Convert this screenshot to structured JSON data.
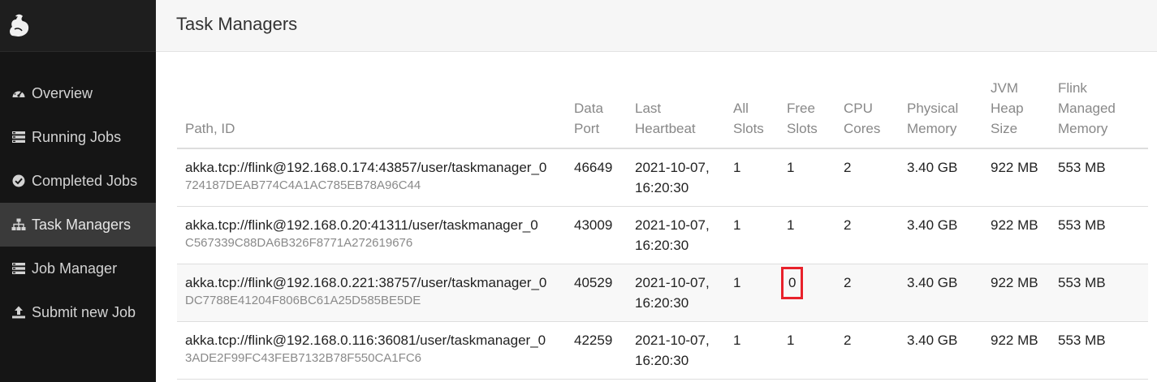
{
  "header": {
    "title": "Task Managers"
  },
  "sidebar": {
    "items": [
      {
        "label": "Overview",
        "icon": "dashboard-icon",
        "active": false
      },
      {
        "label": "Running Jobs",
        "icon": "list-icon",
        "active": false
      },
      {
        "label": "Completed Jobs",
        "icon": "check-circle-icon",
        "active": false
      },
      {
        "label": "Task Managers",
        "icon": "sitemap-icon",
        "active": true
      },
      {
        "label": "Job Manager",
        "icon": "list-icon",
        "active": false
      },
      {
        "label": "Submit new Job",
        "icon": "upload-icon",
        "active": false
      }
    ]
  },
  "table": {
    "columns": [
      {
        "line1": "",
        "line2": "",
        "line3": "Path, ID"
      },
      {
        "line1": "",
        "line2": "Data",
        "line3": "Port"
      },
      {
        "line1": "",
        "line2": "Last",
        "line3": "Heartbeat"
      },
      {
        "line1": "",
        "line2": "All",
        "line3": "Slots"
      },
      {
        "line1": "",
        "line2": "Free",
        "line3": "Slots"
      },
      {
        "line1": "",
        "line2": "CPU",
        "line3": "Cores"
      },
      {
        "line1": "",
        "line2": "Physical",
        "line3": "Memory"
      },
      {
        "line1": "JVM",
        "line2": "Heap",
        "line3": "Size"
      },
      {
        "line1": "Flink",
        "line2": "Managed",
        "line3": "Memory"
      }
    ],
    "rows": [
      {
        "path": "akka.tcp://flink@192.168.0.174:43857/user/taskmanager_0",
        "id": "724187DEAB774C4A1AC785EB78A96C44",
        "data_port": "46649",
        "heartbeat_date": "2021-10-07,",
        "heartbeat_time": "16:20:30",
        "all_slots": "1",
        "free_slots": "1",
        "cpu_cores": "2",
        "physical_memory": "3.40 GB",
        "jvm_heap": "922 MB",
        "flink_managed": "553 MB"
      },
      {
        "path": "akka.tcp://flink@192.168.0.20:41311/user/taskmanager_0",
        "id": "C567339C88DA6B326F8771A272619676",
        "data_port": "43009",
        "heartbeat_date": "2021-10-07,",
        "heartbeat_time": "16:20:30",
        "all_slots": "1",
        "free_slots": "1",
        "cpu_cores": "2",
        "physical_memory": "3.40 GB",
        "jvm_heap": "922 MB",
        "flink_managed": "553 MB"
      },
      {
        "path": "akka.tcp://flink@192.168.0.221:38757/user/taskmanager_0",
        "id": "DC7788E41204F806BC61A25D585BE5DE",
        "data_port": "40529",
        "heartbeat_date": "2021-10-07,",
        "heartbeat_time": "16:20:30",
        "all_slots": "1",
        "free_slots": "0",
        "cpu_cores": "2",
        "physical_memory": "3.40 GB",
        "jvm_heap": "922 MB",
        "flink_managed": "553 MB"
      },
      {
        "path": "akka.tcp://flink@192.168.0.116:36081/user/taskmanager_0",
        "id": "3ADE2F99FC43FEB7132B78F550CA1FC6",
        "data_port": "42259",
        "heartbeat_date": "2021-10-07,",
        "heartbeat_time": "16:20:30",
        "all_slots": "1",
        "free_slots": "1",
        "cpu_cores": "2",
        "physical_memory": "3.40 GB",
        "jvm_heap": "922 MB",
        "flink_managed": "553 MB"
      }
    ]
  },
  "colors": {
    "sidebar_bg": "#151515",
    "active_bg": "#3a3a3a",
    "highlight": "#e8212b"
  }
}
